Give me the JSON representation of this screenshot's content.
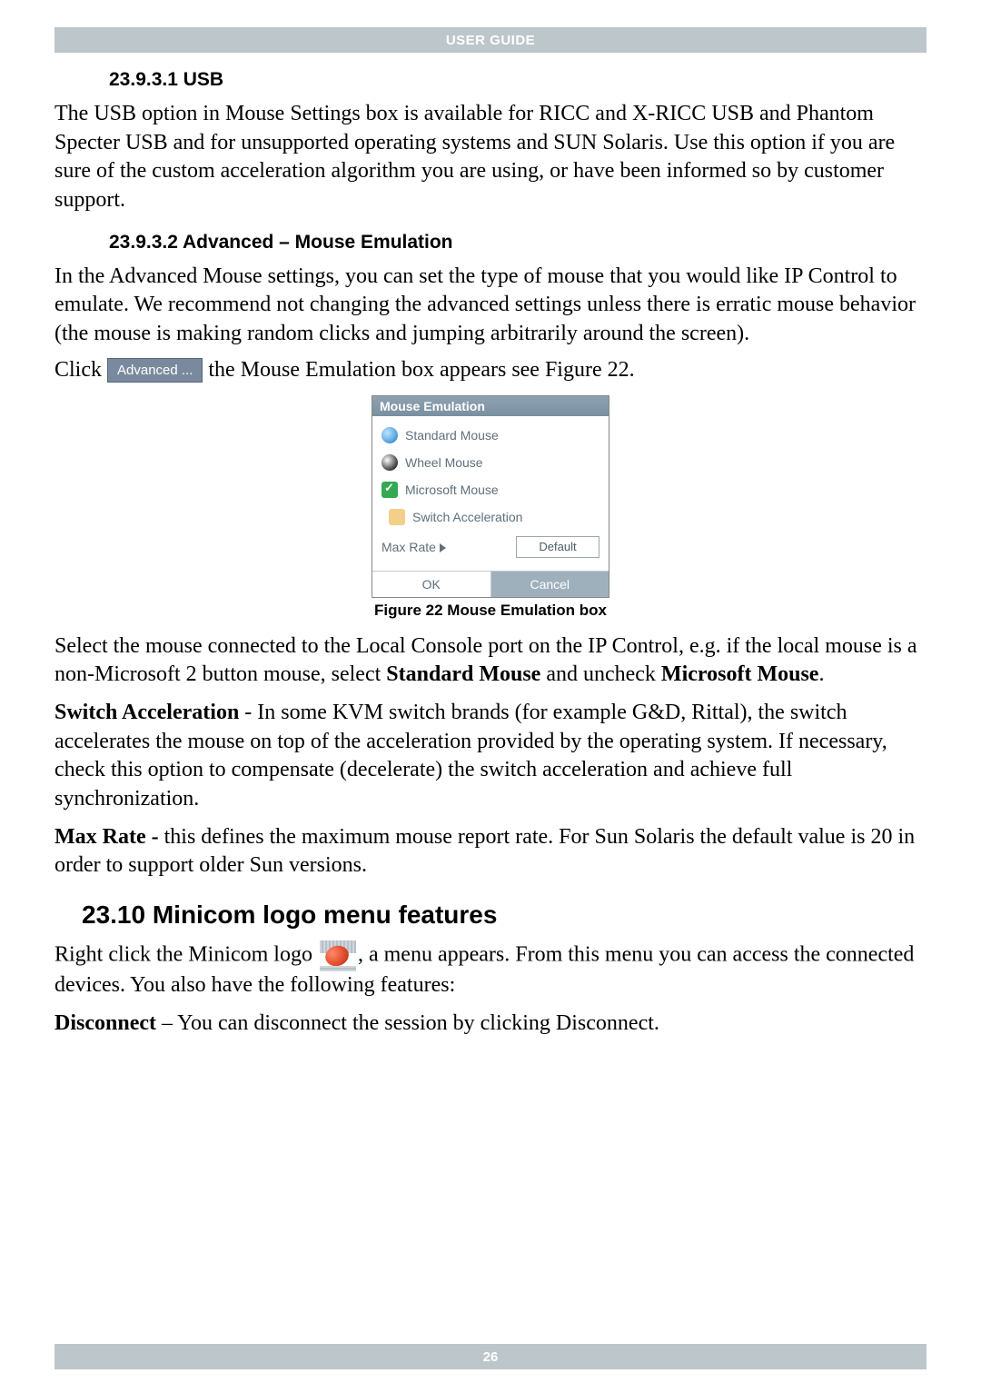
{
  "header": {
    "title": "USER GUIDE"
  },
  "footer": {
    "page": "26"
  },
  "sec1": {
    "num_title": "23.9.3.1 USB",
    "body": "The USB option in Mouse Settings box is available for RICC and X-RICC USB and Phantom Specter USB and for unsupported operating systems and SUN Solaris. Use this option if you are sure of the custom acceleration algorithm you are using, or have been informed so by customer support."
  },
  "sec2": {
    "num_title": "23.9.3.2 Advanced – Mouse Emulation",
    "body": "In the Advanced Mouse settings, you can set the type of mouse that you would like IP Control to emulate. We recommend not changing the advanced settings unless there is erratic mouse behavior (the mouse is making random clicks and jumping arbitrarily around the screen).",
    "click_before": "Click",
    "advanced_btn": "Advanced ...",
    "click_after": " the Mouse Emulation box appears see Figure 22."
  },
  "dialog": {
    "title": "Mouse Emulation",
    "opt_standard": "Standard Mouse",
    "opt_wheel": "Wheel Mouse",
    "opt_ms": "Microsoft Mouse",
    "opt_switch": "Switch Acceleration",
    "rate_label": "Max Rate",
    "rate_value": "Default",
    "ok": "OK",
    "cancel": "Cancel"
  },
  "caption": "Figure 22 Mouse Emulation box",
  "para_select_pre": "Select the mouse connected to the Local Console port on the IP Control, e.g. if the local mouse is a non-Microsoft 2 button mouse, select ",
  "para_select_bold1": "Standard Mouse",
  "para_select_mid": " and uncheck ",
  "para_select_bold2": "Microsoft Mouse",
  "para_select_end": ".",
  "para_switch_label": "Switch Acceleration",
  "para_switch_body": " - In some KVM switch brands (for example G&D, Rittal), the switch accelerates the mouse on top of the acceleration provided by the operating system. If necessary, check this option to compensate (decelerate) the switch acceleration and achieve full synchronization.",
  "para_max_label": "Max Rate -",
  "para_max_body": " this defines the maximum mouse report rate. For Sun Solaris the default value is 20 in order to support older Sun versions.",
  "sec3": {
    "title": "23.10 Minicom logo menu features",
    "line_pre": "Right click the Minicom logo ",
    "line_post": ", a menu appears. From this menu you can access the connected devices. You also have the following features:",
    "disc_label": "Disconnect",
    "disc_body": " – You can disconnect the session by clicking Disconnect."
  }
}
